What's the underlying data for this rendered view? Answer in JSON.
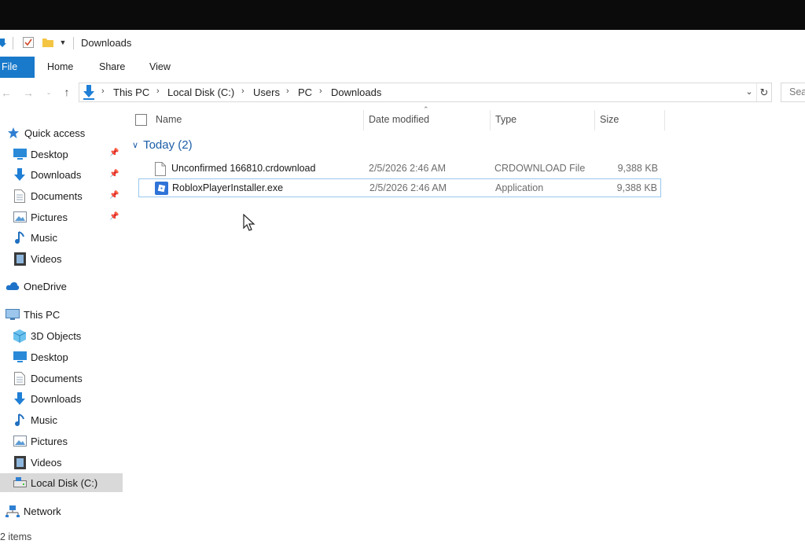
{
  "window": {
    "title": "Downloads"
  },
  "ribbon": {
    "tabs": [
      "File",
      "Home",
      "Share",
      "View"
    ]
  },
  "address": {
    "crumbs": [
      "This PC",
      "Local Disk (C:)",
      "Users",
      "PC",
      "Downloads"
    ],
    "search_placeholder": "Search Downloads"
  },
  "nav": {
    "quick_access": "Quick access",
    "quick_items": [
      {
        "label": "Desktop",
        "icon": "desktop-icon",
        "pinned": true
      },
      {
        "label": "Downloads",
        "icon": "downloads-icon",
        "pinned": true
      },
      {
        "label": "Documents",
        "icon": "documents-icon",
        "pinned": true
      },
      {
        "label": "Pictures",
        "icon": "pictures-icon",
        "pinned": true
      },
      {
        "label": "Music",
        "icon": "music-icon",
        "pinned": false
      },
      {
        "label": "Videos",
        "icon": "videos-icon",
        "pinned": false
      }
    ],
    "onedrive": "OneDrive",
    "this_pc": "This PC",
    "pc_items": [
      {
        "label": "3D Objects",
        "icon": "3d-objects-icon"
      },
      {
        "label": "Desktop",
        "icon": "desktop-icon"
      },
      {
        "label": "Documents",
        "icon": "documents-icon"
      },
      {
        "label": "Downloads",
        "icon": "downloads-icon"
      },
      {
        "label": "Music",
        "icon": "music-icon"
      },
      {
        "label": "Pictures",
        "icon": "pictures-icon"
      },
      {
        "label": "Videos",
        "icon": "videos-icon"
      },
      {
        "label": "Local Disk (C:)",
        "icon": "drive-icon",
        "selected": true
      }
    ],
    "network": "Network"
  },
  "columns": {
    "name": "Name",
    "date": "Date modified",
    "type": "Type",
    "size": "Size"
  },
  "group": {
    "label": "Today (2)"
  },
  "files": [
    {
      "name": "Unconfirmed 166810.crdownload",
      "date": "2/5/2026 2:46 AM",
      "type": "CRDOWNLOAD File",
      "size": "9,388 KB",
      "icon": "blank-file-icon",
      "selected": false
    },
    {
      "name": "RobloxPlayerInstaller.exe",
      "date": "2/5/2026 2:46 AM",
      "type": "Application",
      "size": "9,388 KB",
      "icon": "roblox-app-icon",
      "selected": true
    }
  ],
  "status": {
    "items": "2 items"
  },
  "colors": {
    "accent": "#1979ca",
    "group_text": "#1c5ea8",
    "selection_border": "#99c7ef"
  }
}
